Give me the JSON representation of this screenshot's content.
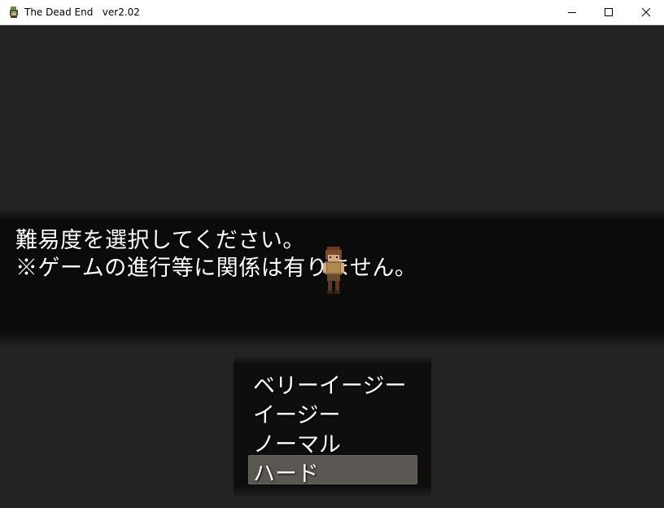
{
  "window": {
    "title": "The Dead End   ver2.02",
    "icon": "game-app-icon",
    "controls": [
      "minimize-icon",
      "maximize-icon",
      "close-icon"
    ]
  },
  "message": {
    "line1": "難易度を選択してください。",
    "line2": "※ゲームの進行等に関係は有りません。"
  },
  "choices": [
    {
      "label": "ベリーイージー"
    },
    {
      "label": "イージー"
    },
    {
      "label": "ノーマル"
    },
    {
      "label": "ハード",
      "selected": true
    }
  ],
  "colors": {
    "background": "#232323",
    "message_window": "#0a0a0a",
    "cursor_highlight": "#5a5651",
    "text": "#ffffff"
  }
}
